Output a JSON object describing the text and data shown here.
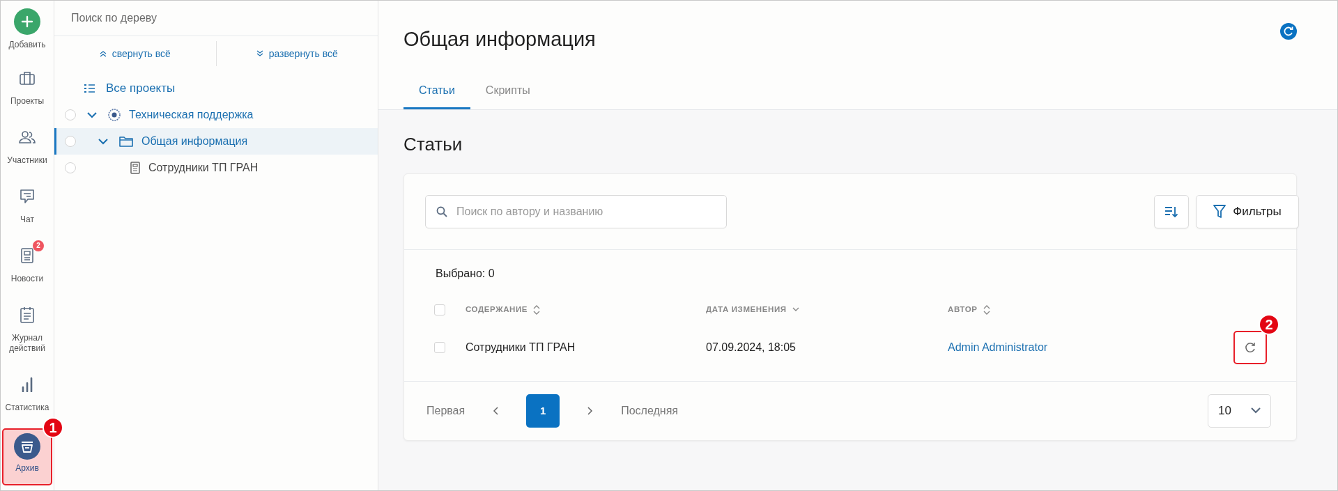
{
  "sidebar": {
    "items": [
      {
        "label": "Добавить",
        "kind": "add",
        "selected": false
      },
      {
        "label": "Проекты",
        "kind": "briefcase",
        "selected": false
      },
      {
        "label": "Участники",
        "kind": "people",
        "selected": false
      },
      {
        "label": "Чат",
        "kind": "chat",
        "selected": false
      },
      {
        "label": "Новости",
        "kind": "news",
        "selected": false,
        "badge": "2"
      },
      {
        "label": "Журнал действий",
        "kind": "journal",
        "selected": false
      },
      {
        "label": "Статистика",
        "kind": "stats",
        "selected": false
      },
      {
        "label": "Архив",
        "kind": "archive",
        "selected": true,
        "callout": "1"
      }
    ]
  },
  "tree": {
    "search": {
      "placeholder": "Поиск по дереву"
    },
    "collapse_all": "свернуть всё",
    "expand_all": "развернуть всё",
    "all_projects": "Все проекты",
    "nodes": [
      {
        "label": "Техническая поддержка",
        "kind": "project",
        "checked": false,
        "expanded": true,
        "selected": false,
        "children": [
          {
            "label": "Общая информация",
            "kind": "folder",
            "checked": false,
            "expanded": true,
            "selected": true,
            "children": [
              {
                "label": "Сотрудники ТП ГРАН",
                "kind": "article",
                "checked": false,
                "selected": false
              }
            ]
          }
        ]
      }
    ]
  },
  "page": {
    "title": "Общая информация",
    "tabs": [
      {
        "label": "Статьи",
        "selected": true
      },
      {
        "label": "Скрипты",
        "selected": false
      }
    ],
    "section_title": "Статьи",
    "search": {
      "placeholder": "Поиск по автору и названию"
    },
    "filter_button": "Фильтры",
    "selected_count": "Выбрано: 0",
    "table": {
      "header_checked": false,
      "columns": [
        {
          "label": "СОДЕРЖАНИЕ",
          "sorted": false
        },
        {
          "label": "ДАТА ИЗМЕНЕНИЯ",
          "sorted": true
        },
        {
          "label": "АВТОР",
          "sorted": false
        }
      ],
      "rows": [
        {
          "title": "Сотрудники ТП ГРАН",
          "date": "07.09.2024, 18:05",
          "author": "Admin Administrator",
          "checked": false,
          "callout": "2"
        }
      ]
    },
    "pagination": {
      "first": "Первая",
      "last": "Последняя",
      "pages": [
        {
          "label": "1",
          "selected": true
        }
      ],
      "page_size": "10"
    }
  }
}
